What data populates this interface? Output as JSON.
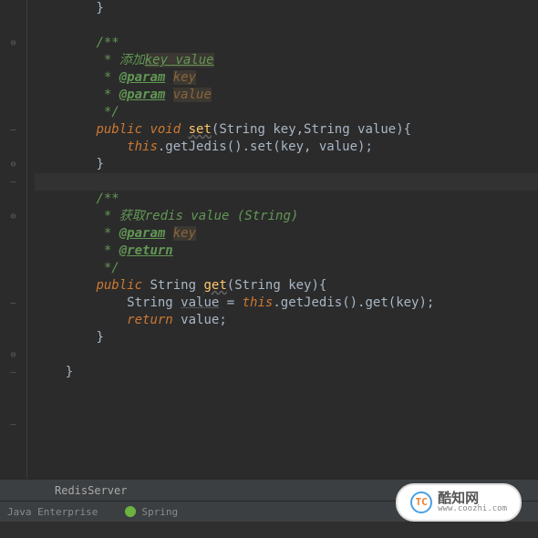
{
  "code": {
    "l0": "        }",
    "c1_open": "/**",
    "c1_l1_pre": " * 添加",
    "c1_l1_k": "key value",
    "c1_l2_star": " * ",
    "c1_tag_param": "@param",
    "c1_p1": "key",
    "c1_p2": "value",
    "c1_close": " */",
    "m1_kw1": "public",
    "m1_kw2": "void",
    "m1_name": "set",
    "m1_sig": "(String key,String value){",
    "m1_body_this": "this",
    "m1_body_rest": ".getJedis().set(key, value);",
    "brace_close": "}",
    "c2_open": "/**",
    "c2_l1": " * 获取redis value (String)",
    "c2_l2_star": " * ",
    "c2_tag_param": "@param",
    "c2_p1": "key",
    "c2_tag_return": "@return",
    "c2_close": " */",
    "m2_kw1": "public",
    "m2_type": "String ",
    "m2_name": "get",
    "m2_sig": "(String key){",
    "m2_b1_a": "String ",
    "m2_b1_var": "value",
    "m2_b1_b": " = ",
    "m2_b1_this": "this",
    "m2_b1_c": ".getJedis().get(key);",
    "m2_ret": "return",
    "m2_ret_sp": " ",
    "m2_ret_var": "value",
    "m2_ret_semi": ";",
    "class_close": "}"
  },
  "gutter": {
    "fold": "⊖",
    "dash": "—"
  },
  "tabs": {
    "file": "RedisServer"
  },
  "tools": {
    "java": "Java Enterprise",
    "spring": "Spring"
  },
  "watermark": {
    "logo": "TC",
    "cn": "酷知网",
    "en": "www.coozhi.com"
  }
}
